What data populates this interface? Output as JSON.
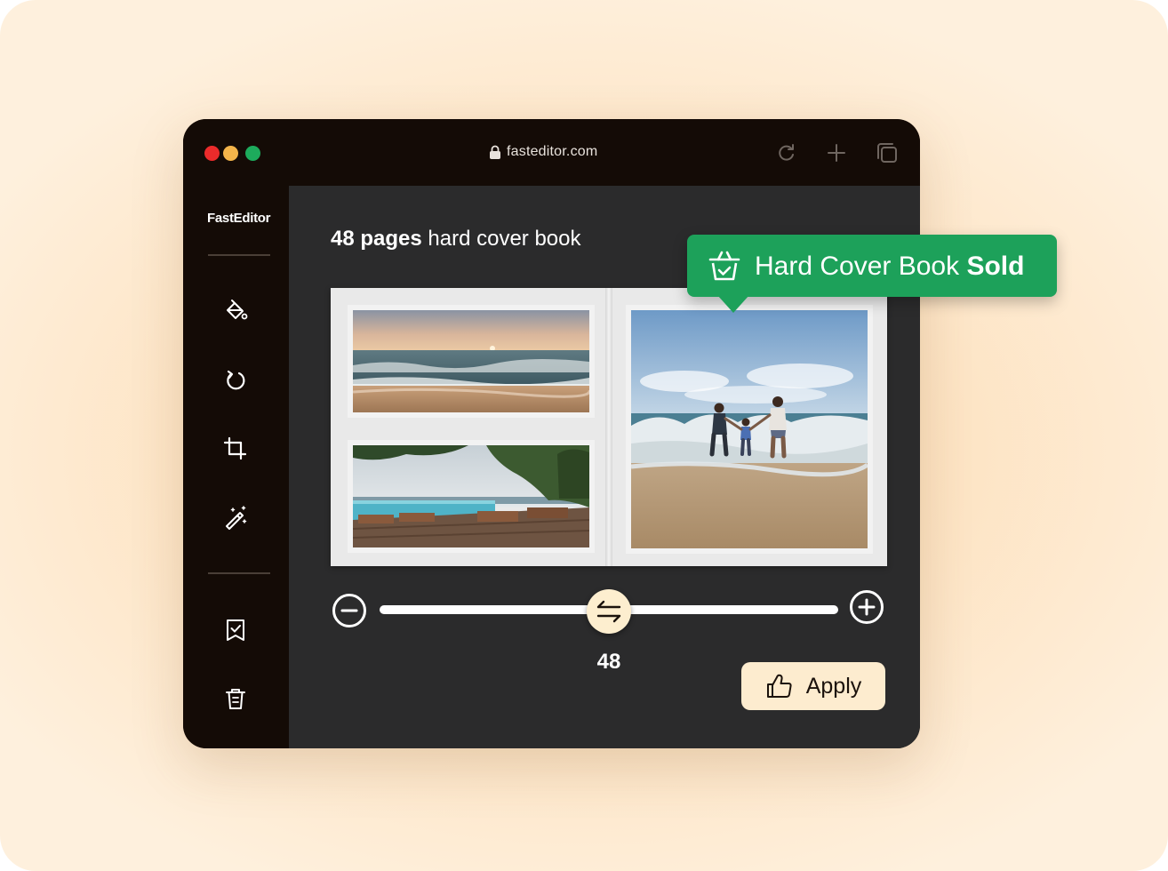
{
  "browser": {
    "url": "fasteditor.com",
    "icons": [
      "lock-icon",
      "reload-icon",
      "new-tab-icon",
      "tabs-icon"
    ]
  },
  "sidebar": {
    "brand": "FastEditor",
    "tools": [
      "paint-bucket-icon",
      "rotate-icon",
      "crop-icon",
      "magic-wand-icon"
    ],
    "actions": [
      "bookmark-check-icon",
      "trash-icon"
    ]
  },
  "main": {
    "heading_bold": "48 pages",
    "heading_rest": " hard cover book",
    "photos": [
      "beach-sunset-photo",
      "resort-pool-photo",
      "family-beach-photo"
    ]
  },
  "slider": {
    "value": "48",
    "level": 0.5,
    "icons": [
      "minus-icon",
      "swap-arrows-icon",
      "plus-icon"
    ]
  },
  "apply_button": {
    "label": "Apply",
    "icon": "thumbs-up-icon"
  },
  "toast": {
    "text": "Hard Cover Book ",
    "bold": "Sold",
    "icon": "basket-check-icon",
    "color": "#1da15a"
  },
  "colors": {
    "window": "#140b06",
    "panel": "#2b2b2c",
    "accent_cream": "#fdeccf",
    "accent_green": "#1da15a"
  }
}
